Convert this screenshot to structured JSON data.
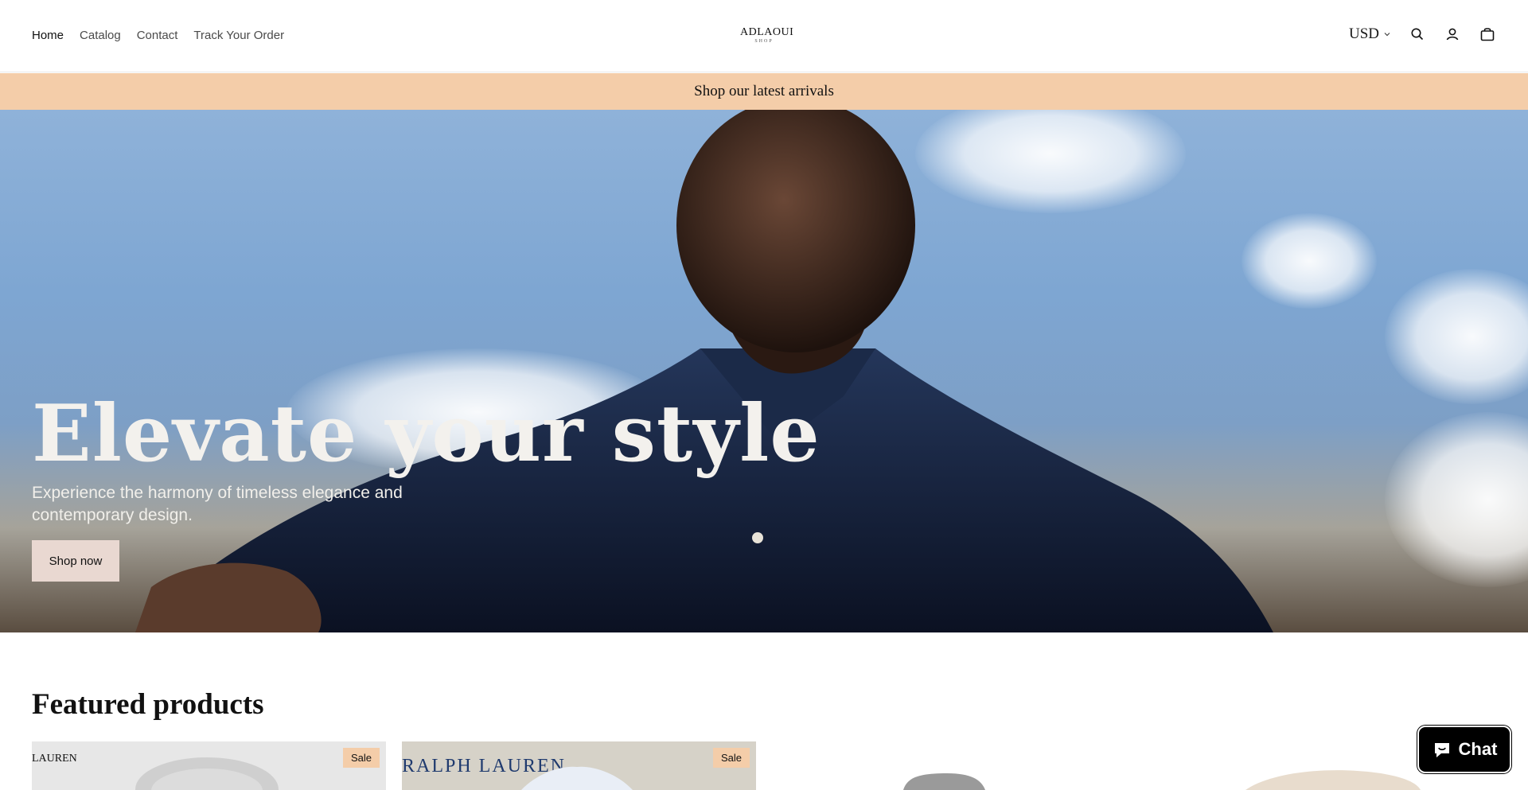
{
  "header": {
    "nav": [
      {
        "label": "Home"
      },
      {
        "label": "Catalog"
      },
      {
        "label": "Contact"
      },
      {
        "label": "Track Your Order"
      }
    ],
    "logo": {
      "main": "ADLAOUI",
      "sub": "SHOP"
    },
    "currency": "USD",
    "icons": [
      "search-icon",
      "account-icon",
      "cart-icon"
    ]
  },
  "announcement": {
    "text": "Shop our latest arrivals"
  },
  "hero": {
    "title": "Elevate your style",
    "subtitle": "Experience the harmony of timeless elegance and contemporary design.",
    "button": "Shop now"
  },
  "featured": {
    "title": "Featured products",
    "cards": [
      {
        "badge": "Sale",
        "brand": "LAUREN"
      },
      {
        "badge": "Sale",
        "brand": "RALPH LAUREN"
      },
      {
        "badge": ""
      },
      {
        "badge": ""
      }
    ]
  },
  "chat": {
    "label": "Chat"
  },
  "colors": {
    "announcement_bg": "#f4cda9",
    "button_bg": "#e9d8d1",
    "chat_bg": "#000000"
  }
}
